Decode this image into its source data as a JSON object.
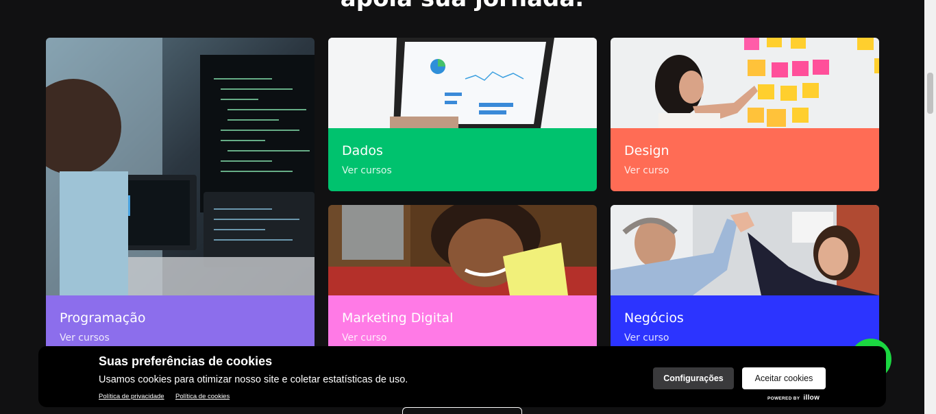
{
  "heading": "apoia sua jornada.",
  "cards": [
    {
      "title": "Programação",
      "link": "Ver cursos",
      "color": "#8c6eec"
    },
    {
      "title": "Dados",
      "link": "Ver cursos",
      "color": "#00c26e"
    },
    {
      "title": "Design",
      "link": "Ver curso",
      "color": "#ff6c55"
    },
    {
      "title": "Marketing Digital",
      "link": "Ver curso",
      "color": "#ff7ae6"
    },
    {
      "title": "Negócios",
      "link": "Ver curso",
      "color": "#2c34ff"
    }
  ],
  "cookie": {
    "title": "Suas preferências de cookies",
    "text": "Usamos cookies para otimizar nosso site e coletar estatísticas de uso.",
    "privacy_link": "Política de privacidade",
    "cookies_link": "Política de cookies",
    "config_button": "Configurações",
    "accept_button": "Aceitar cookies",
    "powered_by": "POWERED BY",
    "powered_brand": "illow"
  },
  "icons": {
    "chat": "whatsapp-icon"
  }
}
